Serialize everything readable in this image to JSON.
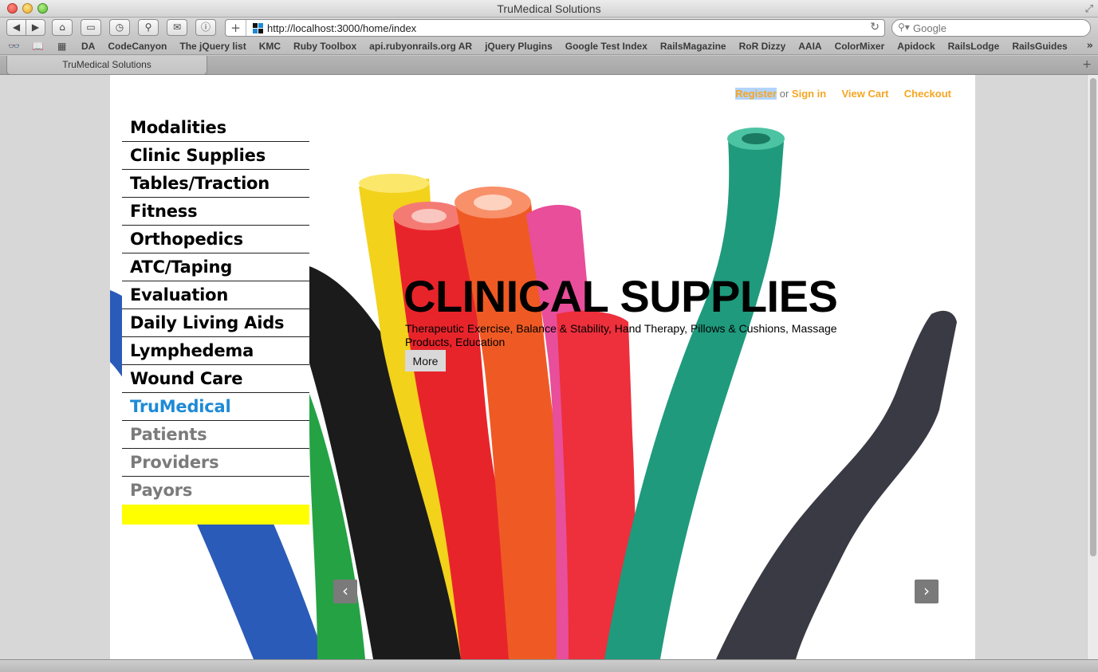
{
  "window": {
    "title": "TruMedical Solutions"
  },
  "toolbar": {
    "url": "http://localhost:3000/home/index",
    "search_placeholder": "Google"
  },
  "bookmarks": [
    "DA",
    "CodeCanyon",
    "The jQuery list",
    "KMC",
    "Ruby Toolbox",
    "api.rubyonrails.org AR",
    "jQuery Plugins",
    "Google Test Index",
    "RailsMagazine",
    "RoR Dizzy",
    "AAIA",
    "ColorMixer",
    "Apidock",
    "RailsLodge",
    "RailsGuides"
  ],
  "tabs": [
    {
      "label": "TruMedical Solutions"
    }
  ],
  "header": {
    "register": "Register",
    "or": "or",
    "sign_in": "Sign in",
    "view_cart": "View Cart",
    "checkout": "Checkout"
  },
  "nav": {
    "items": [
      "Modalities",
      "Clinic Supplies",
      "Tables/Traction",
      "Fitness",
      "Orthopedics",
      "ATC/Taping",
      "Evaluation",
      "Daily Living Aids",
      "Lymphedema",
      "Wound Care"
    ],
    "active": "TruMedical",
    "secondary": [
      "Patients",
      "Providers",
      "Payors"
    ]
  },
  "hero": {
    "title": "CLINICAL SUPPLIES",
    "subtitle": "Therapeutic Exercise, Balance & Stability, Hand Therapy, Pillows & Cushions, Massage Products, Education",
    "button": "More"
  },
  "carousel": {
    "prev": "‹",
    "next": "›"
  },
  "colors": {
    "accent_orange": "#f5a623",
    "active_blue": "#1e8ad6",
    "muted_gray": "#7b7b7b",
    "nav_highlight": "#ffff00"
  }
}
